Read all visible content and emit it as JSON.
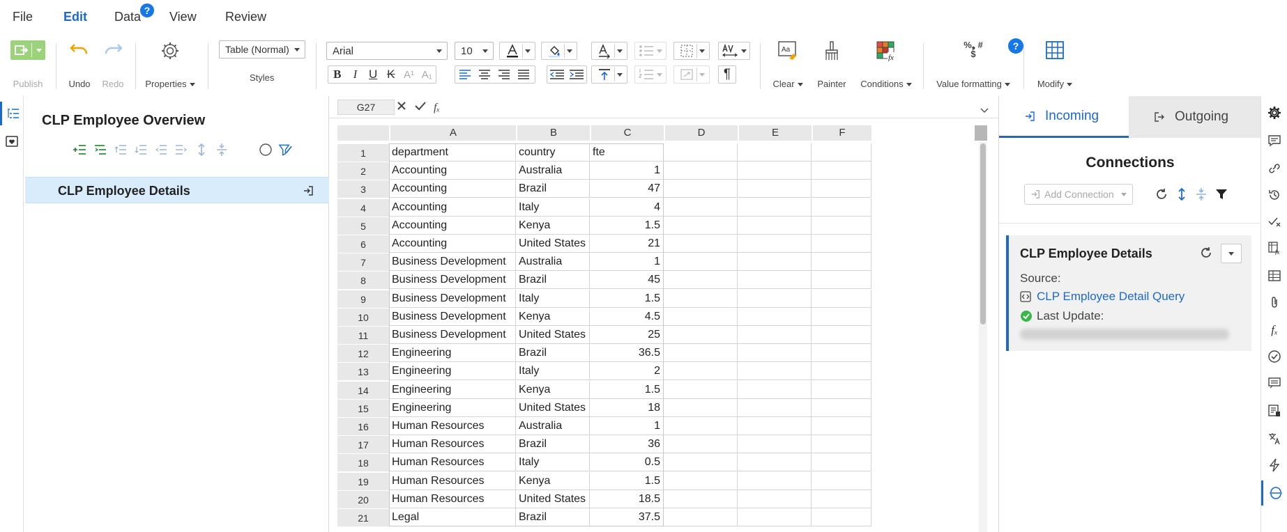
{
  "menu": {
    "file": "File",
    "edit": "Edit",
    "data": "Data",
    "view": "View",
    "review": "Review",
    "help": "?"
  },
  "ribbon": {
    "publish": "Publish",
    "undo": "Undo",
    "redo": "Redo",
    "properties": "Properties",
    "styles_value": "Table (Normal)",
    "styles": "Styles",
    "font_name": "Arial",
    "font_size": "10",
    "clear": "Clear",
    "painter": "Painter",
    "conditions": "Conditions",
    "value_formatting": "Value formatting",
    "value_format_glyph": "%❟ # $",
    "modify": "Modify",
    "help": "?"
  },
  "outline": {
    "title": "CLP Employee Overview",
    "item": "CLP Employee Details"
  },
  "formula_bar": {
    "cell_ref": "G27"
  },
  "grid": {
    "columns": [
      "A",
      "B",
      "C",
      "D",
      "E",
      "F"
    ],
    "rows": [
      {
        "n": "1",
        "a": "department",
        "b": "country",
        "c": "fte"
      },
      {
        "n": "2",
        "a": "Accounting",
        "b": "Australia",
        "c": "1"
      },
      {
        "n": "3",
        "a": "Accounting",
        "b": "Brazil",
        "c": "47"
      },
      {
        "n": "4",
        "a": "Accounting",
        "b": "Italy",
        "c": "4"
      },
      {
        "n": "5",
        "a": "Accounting",
        "b": "Kenya",
        "c": "1.5"
      },
      {
        "n": "6",
        "a": "Accounting",
        "b": "United States",
        "c": "21"
      },
      {
        "n": "7",
        "a": "Business Development",
        "b": "Australia",
        "c": "1"
      },
      {
        "n": "8",
        "a": "Business Development",
        "b": "Brazil",
        "c": "45"
      },
      {
        "n": "9",
        "a": "Business Development",
        "b": "Italy",
        "c": "1.5"
      },
      {
        "n": "10",
        "a": "Business Development",
        "b": "Kenya",
        "c": "4.5"
      },
      {
        "n": "11",
        "a": "Business Development",
        "b": "United States",
        "c": "25"
      },
      {
        "n": "12",
        "a": "Engineering",
        "b": "Brazil",
        "c": "36.5"
      },
      {
        "n": "13",
        "a": "Engineering",
        "b": "Italy",
        "c": "2"
      },
      {
        "n": "14",
        "a": "Engineering",
        "b": "Kenya",
        "c": "1.5"
      },
      {
        "n": "15",
        "a": "Engineering",
        "b": "United States",
        "c": "18"
      },
      {
        "n": "16",
        "a": "Human Resources",
        "b": "Australia",
        "c": "1"
      },
      {
        "n": "17",
        "a": "Human Resources",
        "b": "Brazil",
        "c": "36"
      },
      {
        "n": "18",
        "a": "Human Resources",
        "b": "Italy",
        "c": "0.5"
      },
      {
        "n": "19",
        "a": "Human Resources",
        "b": "Kenya",
        "c": "1.5"
      },
      {
        "n": "20",
        "a": "Human Resources",
        "b": "United States",
        "c": "18.5"
      },
      {
        "n": "21",
        "a": "Legal",
        "b": "Brazil",
        "c": "37.5"
      }
    ]
  },
  "connections": {
    "tab_incoming": "Incoming",
    "tab_outgoing": "Outgoing",
    "title": "Connections",
    "add_connection": "Add Connection",
    "card": {
      "name": "CLP Employee Details",
      "source_label": "Source:",
      "source_link": "CLP Employee Detail Query",
      "last_update_label": "Last Update:"
    }
  },
  "colors": {
    "accent": "#1b6ac9",
    "help_badge": "#1677e5",
    "selected_row": "#d9ecfb",
    "success": "#3bb54a",
    "undo": "#f0a500",
    "publish": "#9bd27a"
  }
}
